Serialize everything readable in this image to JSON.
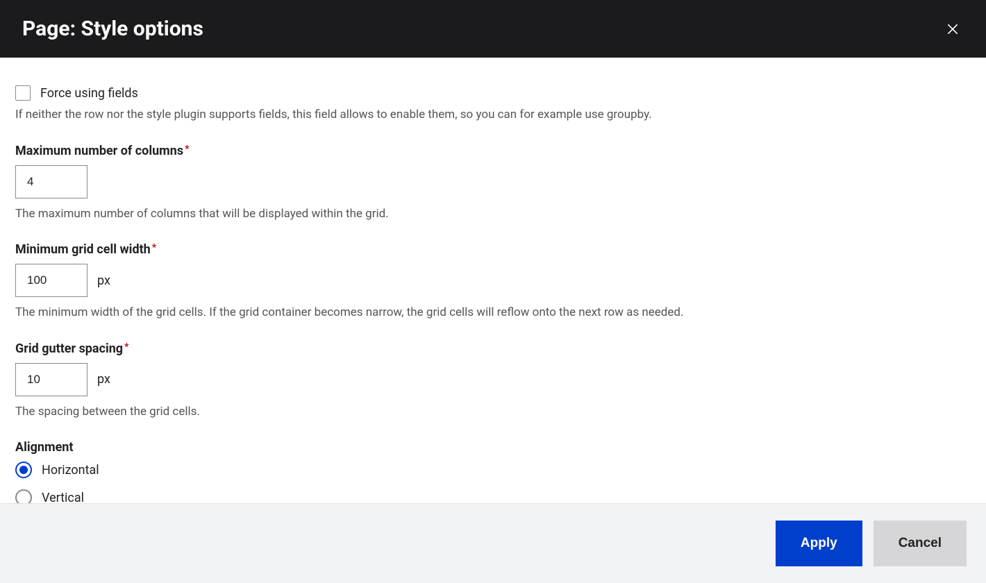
{
  "header": {
    "title": "Page: Style options"
  },
  "form": {
    "force_fields": {
      "label": "Force using fields",
      "checked": false,
      "description": "If neither the row nor the style plugin supports fields, this field allows to enable them, so you can for example use groupby."
    },
    "max_columns": {
      "label": "Maximum number of columns",
      "required": true,
      "value": "4",
      "description": "The maximum number of columns that will be displayed within the grid."
    },
    "min_cell_width": {
      "label": "Minimum grid cell width",
      "required": true,
      "value": "100",
      "suffix": "px",
      "description": "The minimum width of the grid cells. If the grid container becomes narrow, the grid cells will reflow onto the next row as needed."
    },
    "gutter_spacing": {
      "label": "Grid gutter spacing",
      "required": true,
      "value": "10",
      "suffix": "px",
      "description": "The spacing between the grid cells."
    },
    "alignment": {
      "label": "Alignment",
      "options": [
        {
          "label": "Horizontal",
          "value": "horizontal",
          "checked": true
        },
        {
          "label": "Vertical",
          "value": "vertical",
          "checked": false
        }
      ]
    },
    "required_mark": "*"
  },
  "footer": {
    "apply_label": "Apply",
    "cancel_label": "Cancel"
  }
}
